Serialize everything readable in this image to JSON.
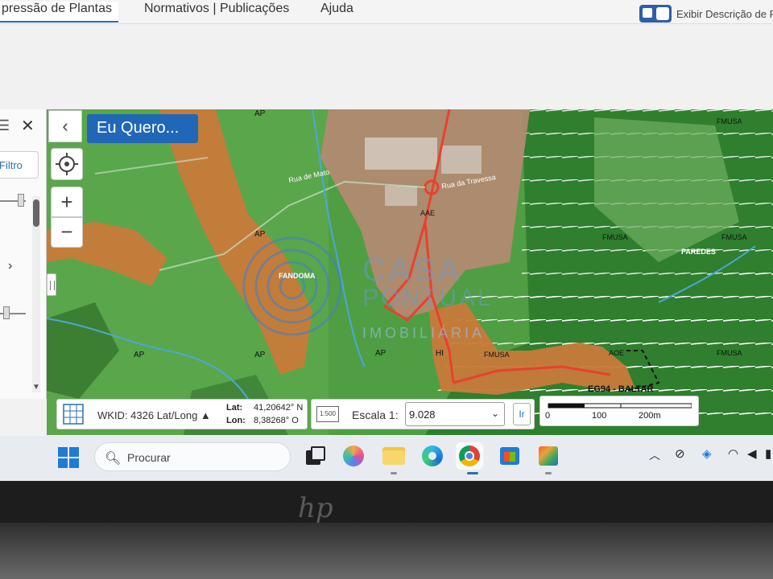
{
  "nav": {
    "tabs": [
      "pressão de Plantas",
      "Normativos | Publicações",
      "Ajuda"
    ],
    "toggle_label": "Exibir Descrição de F"
  },
  "panel": {
    "filter_label": "Filtro"
  },
  "map": {
    "eu_quero_label": "Eu Quero...",
    "labels": {
      "ap1": "AP",
      "ap2": "AP",
      "ap3": "AP",
      "ap4": "AP",
      "ap5": "AP",
      "hi": "HI",
      "aae": "AAE",
      "aoe": "AOE",
      "fmusa1": "FMUSA",
      "fmusa2": "FMUSA",
      "fmusa3": "FMUSA",
      "fmusa4": "FMUSA",
      "fmusa5": "FMUSA",
      "fandoma": "FANDOMA",
      "paredes": "PAREDES",
      "baltar": "EG94 - BALTAR",
      "rua_mato": "Rua de Mato",
      "rua_travessa": "Rua da Travessa",
      "watermark_1": "CASA",
      "watermark_2": "PONTUAL",
      "watermark_3": "IMOBILIÁRIA"
    }
  },
  "coords": {
    "wkid": "WKID: 4326 Lat/Long ▲",
    "lat_label": "Lat:",
    "lat_value": "41,20642° N",
    "lon_label": "Lon:",
    "lon_value": "8,38268° O"
  },
  "scale": {
    "label": "Escala 1:",
    "value": "9.028",
    "go_label": "Ir",
    "icon_text": "1:500",
    "bar_labels": [
      "0",
      "100",
      "200m"
    ]
  },
  "taskbar": {
    "search_placeholder": "Procurar"
  },
  "bezel": {
    "logo": "hp"
  }
}
